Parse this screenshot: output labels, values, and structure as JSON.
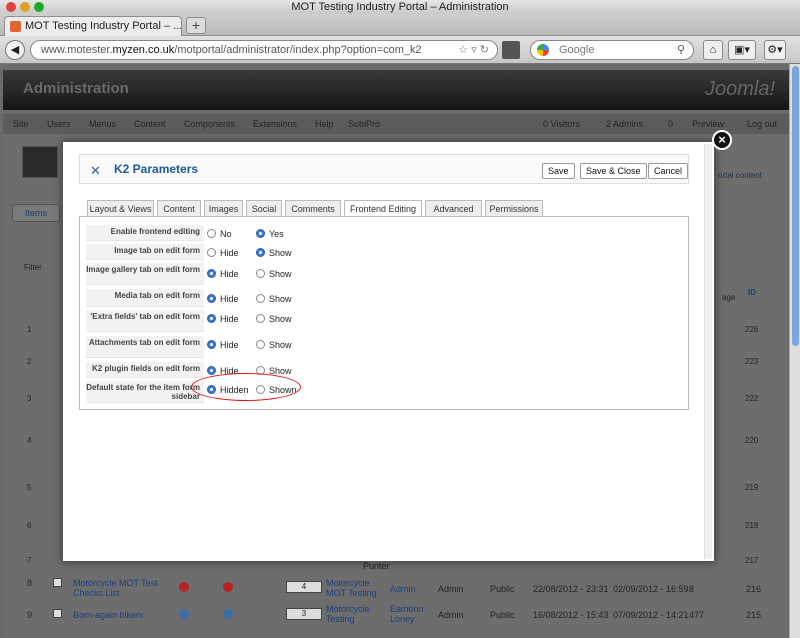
{
  "browser": {
    "window_title": "MOT Testing Industry Portal – Administration",
    "tab_title": "MOT Testing Industry Portal – ...",
    "new_tab_label": "+",
    "url_prefix": "www.motester.",
    "url_domain": "myzen.co.uk",
    "url_path": "/motportal/administrator/index.php?option=com_k2",
    "search_placeholder": "Google"
  },
  "admin": {
    "header_title": "Administration",
    "logo_text": "Joomla!",
    "menu": [
      "Site",
      "Users",
      "Menus",
      "Content",
      "Components",
      "Extensions",
      "Help",
      "SobiPro"
    ],
    "status": {
      "visitors": "0 Visitors",
      "admins": "2 Admins",
      "messages": "0",
      "preview": "Preview",
      "logout": "Log out"
    },
    "sub_label": "Items",
    "filter_label": "Filter",
    "side_link": "ortal content",
    "col_id": "ID",
    "col_age": "age",
    "bg_rows": [
      {
        "num": "1",
        "id": "226"
      },
      {
        "num": "2",
        "id": "223"
      },
      {
        "num": "3",
        "id": "222"
      },
      {
        "num": "4",
        "id": "220"
      },
      {
        "num": "5",
        "id": "219"
      },
      {
        "num": "6",
        "id": "218"
      },
      {
        "num": "7",
        "id": "217",
        "title": "...",
        "punter": "Punter"
      },
      {
        "num": "8",
        "id": "216",
        "title": "Motorcycle MOT Test Checks List",
        "cat": "Motorcycle MOT Testing",
        "author": "Admin",
        "mod": "Admin",
        "access": "Public",
        "created": "22/08/2012 - 23:31",
        "modified": "02/09/2012 - 16:59",
        "hits": "8",
        "order": "4"
      },
      {
        "num": "9",
        "id": "215",
        "title": "Born-again bikers",
        "cat": "Motorcycle Testing",
        "author": "Eamonn Loney",
        "mod": "Admin",
        "access": "Public",
        "created": "16/08/2012 - 15:43",
        "modified": "07/09/2012 - 14:21",
        "hits": "477",
        "order": "3"
      }
    ]
  },
  "modal": {
    "title": "K2 Parameters",
    "buttons": {
      "save": "Save",
      "save_close": "Save & Close",
      "cancel": "Cancel"
    },
    "tabs": [
      "Layout & Views",
      "Content",
      "Images",
      "Social",
      "Comments",
      "Frontend Editing",
      "Advanced",
      "Permissions"
    ],
    "active_tab": "Frontend Editing",
    "params": [
      {
        "label": "Enable frontend editing",
        "opt1": "No",
        "opt2": "Yes",
        "selected": 2
      },
      {
        "label": "Image tab on edit form",
        "opt1": "Hide",
        "opt2": "Show",
        "selected": 2
      },
      {
        "label": "Image gallery tab on edit form",
        "opt1": "Hide",
        "opt2": "Show",
        "selected": 1
      },
      {
        "label": "Media tab on edit form",
        "opt1": "Hide",
        "opt2": "Show",
        "selected": 1
      },
      {
        "label": "'Extra fields' tab on edit form",
        "opt1": "Hide",
        "opt2": "Show",
        "selected": 1
      },
      {
        "label": "Attachments tab on edit form",
        "opt1": "Hide",
        "opt2": "Show",
        "selected": 1
      },
      {
        "label": "K2 plugin fields on edit form",
        "opt1": "Hide",
        "opt2": "Show",
        "selected": 1
      },
      {
        "label": "Default state for the item form sidebar",
        "opt1": "Hidden",
        "opt2": "Shown",
        "selected": 1
      }
    ],
    "close_glyph": "×"
  }
}
